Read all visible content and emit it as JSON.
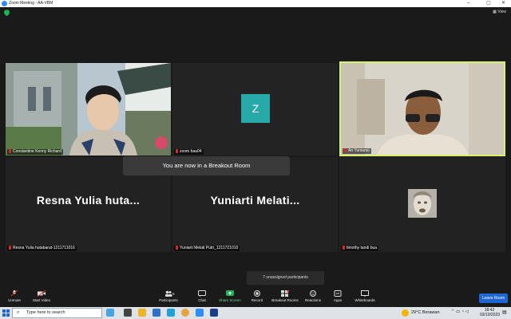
{
  "window": {
    "title": "Zoom Meeting - AA-VBM",
    "controls": [
      "–",
      "▢",
      "✕"
    ]
  },
  "topbar": {
    "view_label": "View"
  },
  "tiles": [
    {
      "name": "Constantine Kenny Richard"
    },
    {
      "name": "zoom baa04",
      "avatar_letter": "Z"
    },
    {
      "name": "Ari Yuniarso"
    },
    {
      "name": "Resna Yulia hutabarat-1211711016",
      "display": "Resna Yulia huta..."
    },
    {
      "name": "Yuniarti Melati Putri_1211721010",
      "display": "Yuniarti Melati..."
    },
    {
      "name": "timothy tandi bua"
    }
  ],
  "banner": "You are now in a Breakout Room",
  "unassigned": "7 unassigned participants",
  "toolbar": {
    "unmute": "Unmute",
    "start_video": "Start Video",
    "participants": "Participants",
    "participants_count": "8",
    "chat": "Chat",
    "share_screen": "Share Screen",
    "record": "Record",
    "breakout_rooms": "Breakout Rooms",
    "reactions": "Reactions",
    "apps": "Apps",
    "whiteboards": "Whiteboards",
    "leave": "Leave Room"
  },
  "taskbar": {
    "search_placeholder": "Type here to search",
    "weather": "29°C  Berawan",
    "time": "18:42",
    "date": "03/10/2023"
  },
  "colors": {
    "speaker_border": "#d6f26b",
    "avatar_teal": "#27a9a9",
    "leave_blue": "#1e66d6",
    "share_green": "#19b254"
  }
}
